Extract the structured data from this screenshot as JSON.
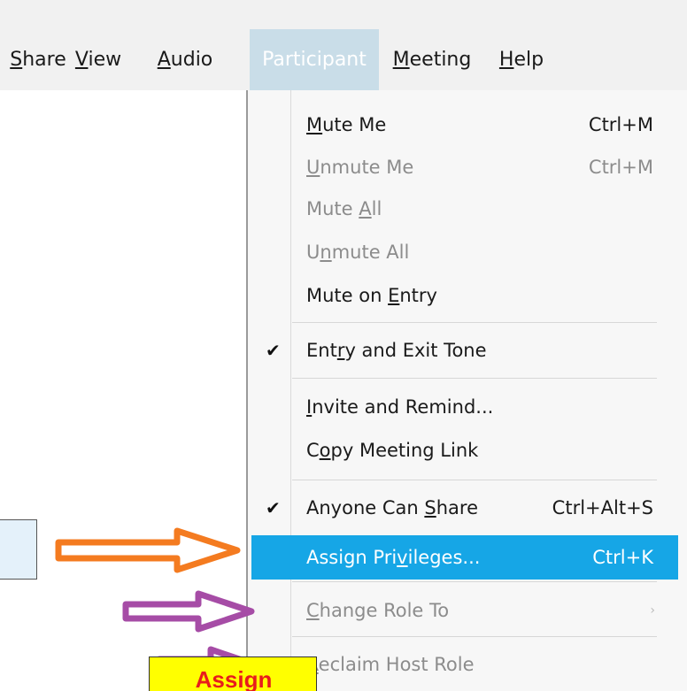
{
  "menubar": {
    "items": [
      {
        "label": "Share",
        "mnemonic": "S",
        "rest": "hare"
      },
      {
        "label": "View",
        "mnemonic": "V",
        "rest": "iew"
      },
      {
        "label": "Audio",
        "mnemonic": "A",
        "rest": "udio"
      },
      {
        "label": "Participant",
        "active": true
      },
      {
        "label": "Meeting",
        "mnemonic": "M",
        "rest": "eeting"
      },
      {
        "label": "Help",
        "mnemonic": "H",
        "rest": "elp"
      }
    ]
  },
  "dropdown": {
    "items": [
      {
        "pre": "",
        "mn": "M",
        "post": "ute Me",
        "shortcut": "Ctrl+M",
        "disabled": false,
        "checked": false
      },
      {
        "pre": "",
        "mn": "U",
        "post": "nmute Me",
        "shortcut": "Ctrl+M",
        "disabled": true,
        "checked": false
      },
      {
        "pre": "Mute ",
        "mn": "A",
        "post": "ll",
        "shortcut": "",
        "disabled": true,
        "checked": false
      },
      {
        "pre": "U",
        "mn": "n",
        "post": "mute All",
        "shortcut": "",
        "disabled": true,
        "checked": false
      },
      {
        "pre": "Mute on ",
        "mn": "E",
        "post": "ntry",
        "shortcut": "",
        "disabled": false,
        "checked": false
      },
      {
        "pre": "Ent",
        "mn": "r",
        "post": "y and Exit Tone",
        "shortcut": "",
        "disabled": false,
        "checked": true
      },
      {
        "pre": "",
        "mn": "I",
        "post": "nvite and Remind...",
        "shortcut": "",
        "disabled": false,
        "checked": false
      },
      {
        "pre": "C",
        "mn": "o",
        "post": "py Meeting Link",
        "shortcut": "",
        "disabled": false,
        "checked": false
      },
      {
        "pre": "Anyone Can ",
        "mn": "S",
        "post": "hare",
        "shortcut": "Ctrl+Alt+S",
        "disabled": false,
        "checked": true
      },
      {
        "pre": "Assign Pri",
        "mn": "v",
        "post": "ileges...",
        "shortcut": "Ctrl+K",
        "disabled": false,
        "checked": false,
        "highlight": true
      },
      {
        "pre": "",
        "mn": "C",
        "post": "hange Role To",
        "shortcut": "",
        "disabled": true,
        "checked": false,
        "submenu": true
      },
      {
        "pre": "",
        "mn": "R",
        "post": "eclaim Host Role",
        "shortcut": "",
        "disabled": true,
        "checked": false
      }
    ],
    "check_glyph": "✔",
    "submenu_glyph": "›"
  },
  "annotations": {
    "yellow_label": "Assign",
    "colors": {
      "orange_arrow": "#f47b20",
      "purple_arrow": "#a64ca6",
      "highlight": "#16a6e6"
    }
  }
}
